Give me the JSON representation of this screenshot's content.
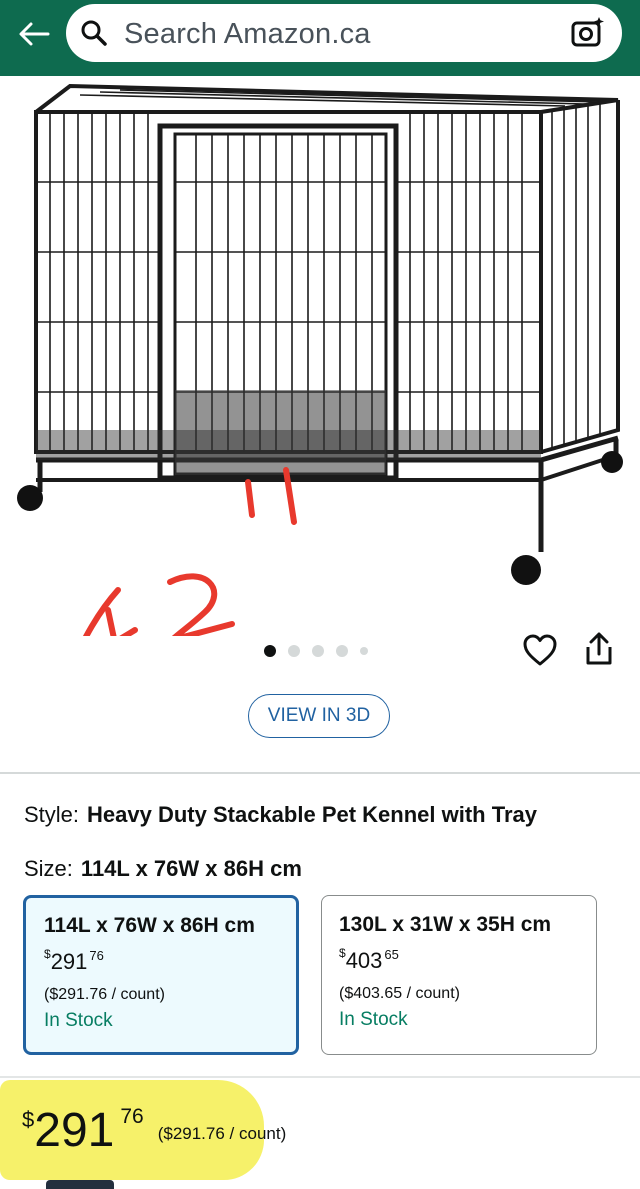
{
  "search": {
    "placeholder": "Search Amazon.ca"
  },
  "gallery": {
    "annotation": "42''",
    "image_count": 5,
    "active_index": 0
  },
  "actions": {
    "view3d_label": "VIEW IN 3D"
  },
  "product": {
    "style_label": "Style:",
    "style_value": "Heavy Duty Stackable Pet Kennel with Tray",
    "size_label": "Size:",
    "size_value": "114L x 76W x 86H cm"
  },
  "options": [
    {
      "dimensions": "114L x 76W x 86H cm",
      "currency": "$",
      "dollars": "291",
      "cents": "76",
      "unit_price": "($291.76 / count)",
      "availability": "In Stock",
      "selected": true
    },
    {
      "dimensions": "130L x 31W x 35H cm",
      "currency": "$",
      "dollars": "403",
      "cents": "65",
      "unit_price": "($403.65 / count)",
      "availability": "In Stock",
      "selected": false
    }
  ],
  "price": {
    "currency": "$",
    "dollars": "291",
    "cents": "76",
    "unit_price": "($291.76 / count)"
  },
  "colors": {
    "header": "#0e6b4f",
    "link": "#2162a1",
    "in_stock": "#067d62",
    "highlight": "#f6f16a",
    "annotation": "#e8392d"
  }
}
